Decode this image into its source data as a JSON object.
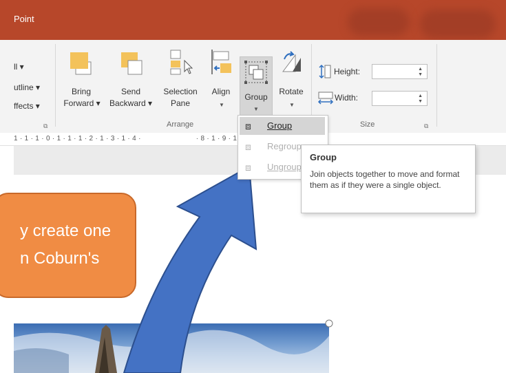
{
  "titlebar": {
    "app_title": "Point"
  },
  "ribbon": {
    "left_partial": {
      "fill": "ll ▾",
      "outline": "utline ▾",
      "effects": "ffects ▾"
    },
    "arrange": {
      "bring_forward": {
        "line1": "Bring",
        "line2": "Forward ▾"
      },
      "send_backward": {
        "line1": "Send",
        "line2": "Backward ▾"
      },
      "selection_pane": {
        "line1": "Selection",
        "line2": "Pane"
      },
      "align": "Align",
      "group": "Group",
      "rotate": "Rotate",
      "label": "Arrange"
    },
    "size": {
      "height_label": "Height:",
      "width_label": "Width:",
      "height_value": "",
      "width_value": "",
      "label": "Size"
    }
  },
  "ruler": {
    "text": "1 · 1 · 1 · 0 · 1 · 1 · 1 · 2 · 1 · 3 · 1 · 4 ·                          · 8 · 1 · 9 · 1 · 10 · 1 · 11 · 1 · 12"
  },
  "group_menu": {
    "items": [
      {
        "label": "Group",
        "enabled": true
      },
      {
        "label": "Regroup",
        "enabled": false
      },
      {
        "label": "Ungroup",
        "enabled": false
      }
    ]
  },
  "tooltip": {
    "title": "Group",
    "body": "Join objects together to move and format them as if they were a single object."
  },
  "slide": {
    "text_line1": "y create one",
    "text_line2": "n Coburn's"
  },
  "colors": {
    "titlebar": "#b7472a",
    "orange_box": "#f08c44",
    "arrow": "#4472c4"
  }
}
